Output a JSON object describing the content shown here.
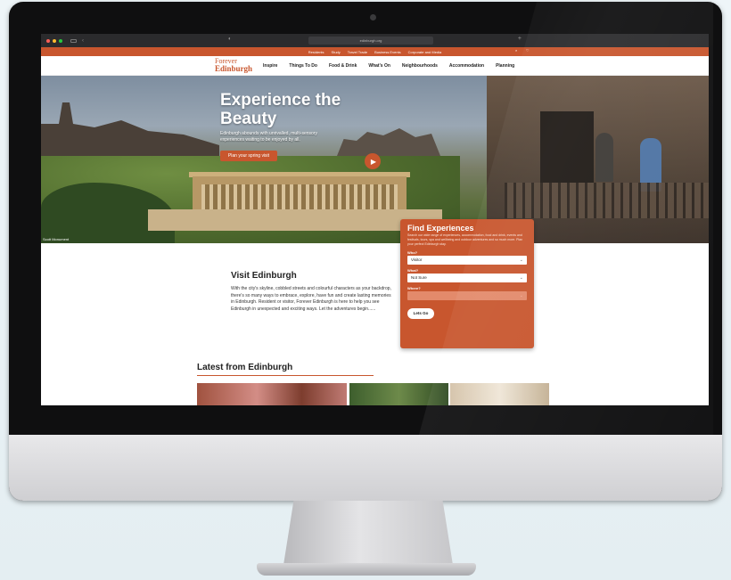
{
  "browser": {
    "url": "edinburgh.org"
  },
  "utility_nav": {
    "items": [
      "Residents",
      "Study",
      "Travel Trade",
      "Business Events",
      "Corporate and Media"
    ]
  },
  "logo": {
    "line1": "Forever",
    "line2": "Edinburgh"
  },
  "main_nav": {
    "items": [
      "Inspire",
      "Things To Do",
      "Food & Drink",
      "What's On",
      "Neighbourhoods",
      "Accommodation",
      "Planning"
    ]
  },
  "hero": {
    "title": "Experience the Beauty",
    "subtitle": "Edinburgh abounds with unrivalled, multi-sensory experiences waiting to be enjoyed by all.",
    "cta": "Plan your spring visit",
    "caption": "Scott Monument"
  },
  "visit": {
    "title": "Visit Edinburgh",
    "body": "With the city's skyline, cobbled streets and colourful characters as your backdrop, there's so many ways to embrace, explore, have fun and create lasting memories in Edinburgh. Resident or visitor, Forever Edinburgh is here to help you see Edinburgh in unexpected and exciting ways. Let the adventures begin......"
  },
  "find": {
    "title": "Find Experiences",
    "description": "Search our wide range of experiences, accommodation, food and drink, events and festivals, tours, spa and wellbeing and outdoor adventures and so much more. Plan your perfect Edinburgh stay.",
    "who_label": "Who?",
    "who_value": "Visitor",
    "what_label": "What?",
    "what_value": "Not Sure",
    "where_label": "Where?",
    "where_value": "",
    "button": "Lets Go"
  },
  "latest": {
    "title": "Latest from Edinburgh"
  },
  "colors": {
    "brand": "#c8562e"
  }
}
